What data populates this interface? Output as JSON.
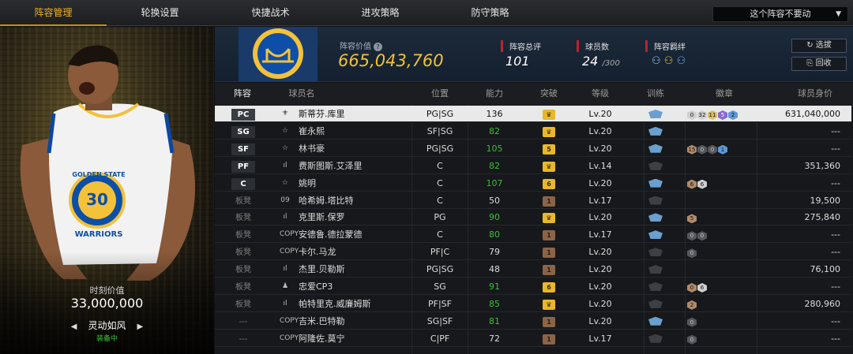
{
  "tabs": [
    "阵容管理",
    "轮换设置",
    "快捷战术",
    "进攻策略",
    "防守策略"
  ],
  "active_tab": 0,
  "dropdown": {
    "value": "这个阵容不要动"
  },
  "hero": {
    "jersey_team": "GOLDEN STATE",
    "jersey_number": "30",
    "jersey_name": "WARRIORS",
    "value_label": "时刻价值",
    "value": "33,000,000",
    "card_name": "灵动如风",
    "status": "装备中"
  },
  "info": {
    "lineup_value_label": "阵容价值",
    "lineup_value": "665,043,760",
    "rating_label": "阵容总评",
    "rating": "101",
    "players_label": "球员数",
    "players": "24",
    "players_max": "/300",
    "bond_label": "阵容羁绊",
    "btn_select": "选拔",
    "btn_recycle": "回收"
  },
  "colors": {
    "accent": "#f0b020",
    "selected_row": "#e9e9e9",
    "green": "#3dbb3d",
    "header_bg": "#1c2a3a"
  },
  "table": {
    "headers": [
      "阵容",
      "球员名",
      "位置",
      "能力",
      "突破",
      "等级",
      "训练",
      "徽章",
      "球员身价"
    ],
    "rows": [
      {
        "slot": "PC",
        "type": "⚜",
        "name": "斯蒂芬.库里",
        "pos": "PG|SG",
        "ability": "136",
        "ab_green": false,
        "breakthrough": "crown",
        "level": "Lv.20",
        "train": "blue",
        "badges": [
          [
            "b-w",
            "0"
          ],
          [
            "b-w",
            "32"
          ],
          [
            "b-y",
            "11"
          ],
          [
            "b-p",
            "5"
          ],
          [
            "b-b",
            "2"
          ]
        ],
        "price": "631,040,000"
      },
      {
        "slot": "SG",
        "type": "☆",
        "name": "崔永熙",
        "pos": "SF|SG",
        "ability": "82",
        "ab_green": true,
        "breakthrough": "crown",
        "level": "Lv.20",
        "train": "blue",
        "badges": [],
        "price": "---"
      },
      {
        "slot": "SF",
        "type": "☆",
        "name": "林书豪",
        "pos": "PG|SG",
        "ability": "105",
        "ab_green": true,
        "breakthrough": "5",
        "level": "Lv.20",
        "train": "blue",
        "badges": [
          [
            "b-t",
            "15"
          ],
          [
            "b-d",
            "0"
          ],
          [
            "b-d",
            "0"
          ],
          [
            "b-b",
            "1"
          ]
        ],
        "price": "---"
      },
      {
        "slot": "PF",
        "type": "ıl",
        "name": "费斯图斯.艾泽里",
        "pos": "C",
        "ability": "82",
        "ab_green": true,
        "breakthrough": "crown",
        "level": "Lv.14",
        "train": "gray",
        "badges": [],
        "price": "351,360"
      },
      {
        "slot": "C",
        "type": "☆",
        "name": "姚明",
        "pos": "C",
        "ability": "107",
        "ab_green": true,
        "breakthrough": "6",
        "level": "Lv.20",
        "train": "blue",
        "badges": [
          [
            "b-t",
            "6"
          ],
          [
            "b-w",
            "6"
          ]
        ],
        "price": "---"
      },
      {
        "slot": "板凳",
        "type": "09",
        "name": "哈希姆.塔比特",
        "pos": "C",
        "ability": "50",
        "ab_green": false,
        "breakthrough": "1",
        "level": "Lv.17",
        "train": "gray",
        "badges": [],
        "price": "19,500"
      },
      {
        "slot": "板凳",
        "type": "ıl",
        "name": "克里斯.保罗",
        "pos": "PG",
        "ability": "90",
        "ab_green": true,
        "breakthrough": "crown",
        "level": "Lv.20",
        "train": "blue",
        "badges": [
          [
            "b-t",
            "5"
          ]
        ],
        "price": "275,840"
      },
      {
        "slot": "板凳",
        "type": "COPY",
        "name": "安德鲁.德拉蒙德",
        "pos": "C",
        "ability": "80",
        "ab_green": true,
        "breakthrough": "1",
        "level": "Lv.17",
        "train": "blue",
        "badges": [
          [
            "b-d",
            "0"
          ],
          [
            "b-d",
            "0"
          ]
        ],
        "price": "---"
      },
      {
        "slot": "板凳",
        "type": "COPY",
        "name": "卡尔.马龙",
        "pos": "PF|C",
        "ability": "79",
        "ab_green": false,
        "breakthrough": "1",
        "level": "Lv.20",
        "train": "gray",
        "badges": [
          [
            "b-d",
            "0"
          ]
        ],
        "price": "---"
      },
      {
        "slot": "板凳",
        "type": "ıl",
        "name": "杰里.贝勒斯",
        "pos": "PG|SG",
        "ability": "48",
        "ab_green": false,
        "breakthrough": "1",
        "level": "Lv.20",
        "train": "gray",
        "badges": [],
        "price": "76,100"
      },
      {
        "slot": "板凳",
        "type": "♟",
        "name": "忠爱CP3",
        "pos": "SG",
        "ability": "91",
        "ab_green": true,
        "breakthrough": "6",
        "level": "Lv.20",
        "train": "gray",
        "badges": [
          [
            "b-t",
            "0"
          ],
          [
            "b-w",
            "6"
          ]
        ],
        "price": "---"
      },
      {
        "slot": "板凳",
        "type": "ıl",
        "name": "帕特里克.威廉姆斯",
        "pos": "PF|SF",
        "ability": "85",
        "ab_green": true,
        "breakthrough": "crown",
        "level": "Lv.20",
        "train": "gray",
        "badges": [
          [
            "b-t",
            "2"
          ]
        ],
        "price": "280,960"
      },
      {
        "slot": "---",
        "type": "COPY",
        "name": "吉米.巴特勒",
        "pos": "SG|SF",
        "ability": "81",
        "ab_green": true,
        "breakthrough": "1",
        "level": "Lv.20",
        "train": "blue",
        "badges": [
          [
            "b-d",
            "0"
          ]
        ],
        "price": "---"
      },
      {
        "slot": "---",
        "type": "COPY",
        "name": "阿隆佐.莫宁",
        "pos": "C|PF",
        "ability": "72",
        "ab_green": false,
        "breakthrough": "1",
        "level": "Lv.17",
        "train": "gray",
        "badges": [
          [
            "b-d",
            "0"
          ]
        ],
        "price": "---"
      }
    ]
  }
}
